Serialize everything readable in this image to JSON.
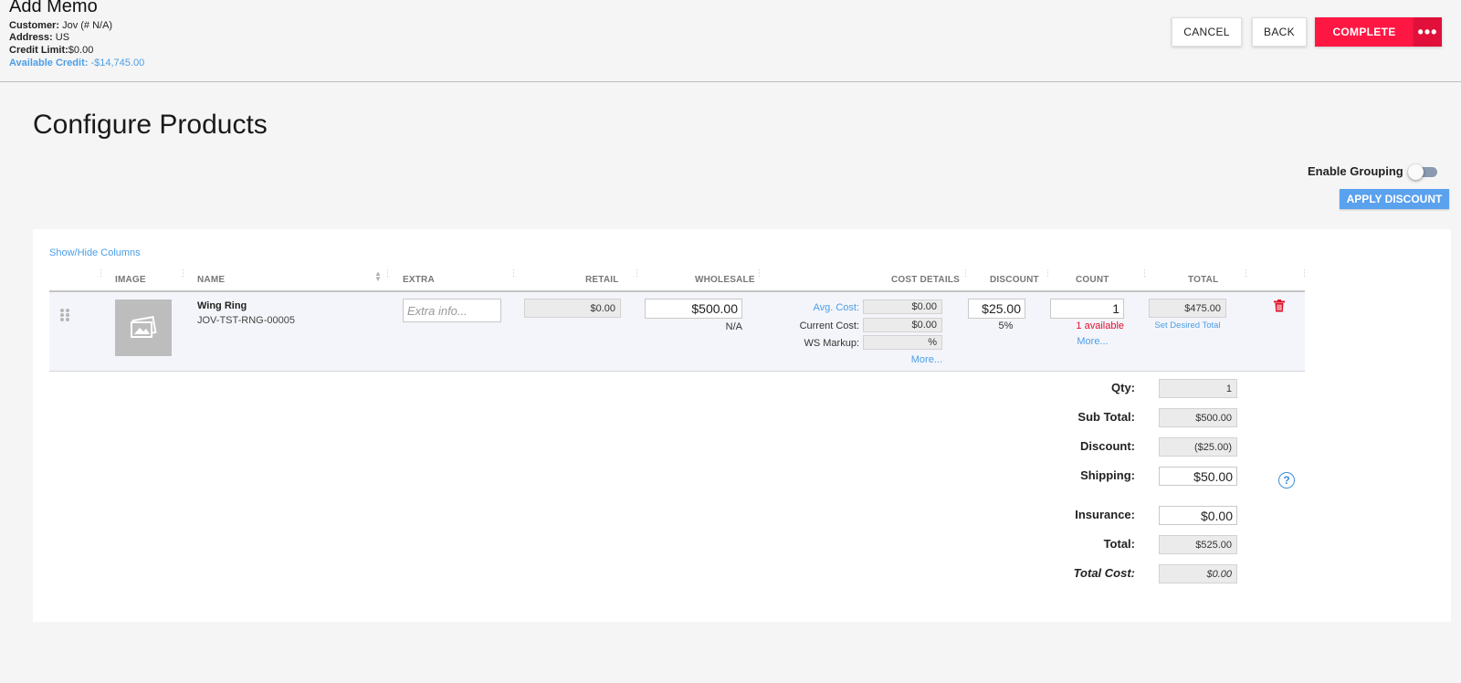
{
  "header": {
    "title": "Add Memo",
    "customer_label": "Customer:",
    "customer_value": "Jov (# N/A)",
    "address_label": "Address:",
    "address_value": "US",
    "credit_limit_label": "Credit Limit:",
    "credit_limit_value": "$0.00",
    "available_credit_label": "Available Credit:",
    "available_credit_value": "-$14,745.00",
    "buttons": {
      "cancel": "CANCEL",
      "back": "BACK",
      "complete": "COMPLETE",
      "more": "•••"
    }
  },
  "page_title": "Configure Products",
  "enable_grouping": {
    "label": "Enable Grouping",
    "on": false
  },
  "apply_discount": "APPLY DISCOUNT",
  "table": {
    "show_hide": "Show/Hide Columns",
    "columns": {
      "image": "IMAGE",
      "name": "NAME",
      "extra": "EXTRA",
      "retail": "RETAIL",
      "wholesale": "WHOLESALE",
      "cost_details": "COST DETAILS",
      "discount": "DISCOUNT",
      "count": "COUNT",
      "total": "TOTAL"
    },
    "row": {
      "name": "Wing Ring",
      "sku": "JOV-TST-RNG-00005",
      "extra_placeholder": "Extra info...",
      "retail": "$0.00",
      "wholesale": "$500.00",
      "wholesale_sub": "N/A",
      "avg_cost_label": "Avg. Cost:",
      "avg_cost": "$0.00",
      "current_cost_label": "Current Cost:",
      "current_cost": "$0.00",
      "ws_markup_label": "WS Markup:",
      "ws_markup": "%",
      "cost_more": "More...",
      "discount": "$25.00",
      "discount_pct": "5%",
      "count": "1",
      "available": "1 available",
      "count_more": "More...",
      "total": "$475.00",
      "set_desired_total": "Set Desired Total"
    }
  },
  "summary": {
    "qty_label": "Qty:",
    "qty": "1",
    "subtotal_label": "Sub Total:",
    "subtotal": "$500.00",
    "discount_label": "Discount:",
    "discount": "($25.00)",
    "shipping_label": "Shipping:",
    "shipping": "$50.00",
    "insurance_label": "Insurance:",
    "insurance": "$0.00",
    "total_label": "Total:",
    "total": "$525.00",
    "total_cost_label": "Total Cost:",
    "total_cost": "$0.00",
    "help": "?"
  },
  "colors": {
    "accent": "#ff1744",
    "link": "#4a9ee8",
    "apply": "#5aa1ee",
    "error": "#e01030"
  }
}
